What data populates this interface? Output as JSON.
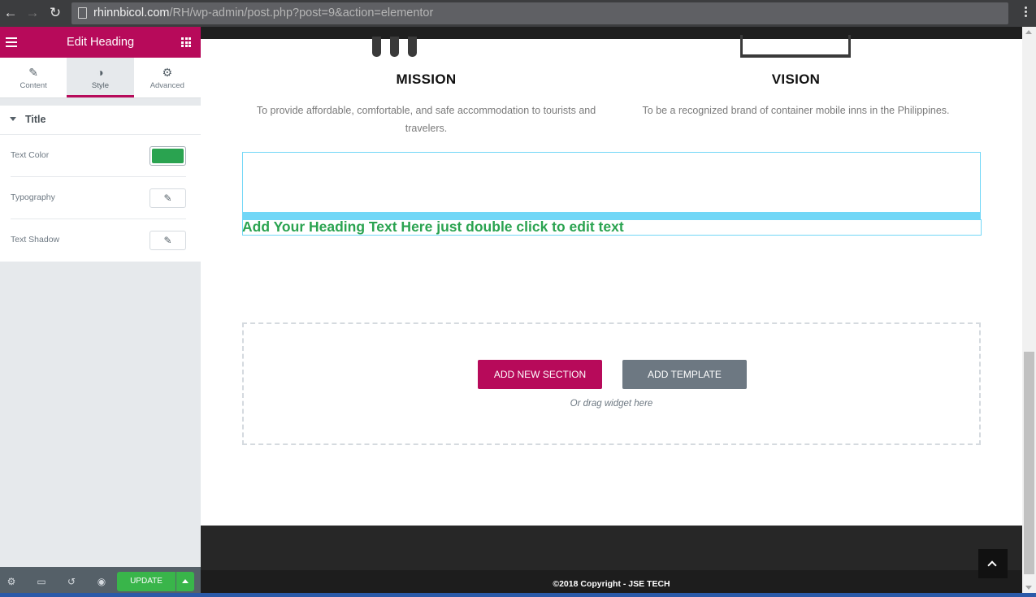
{
  "browser": {
    "url_host": "rhinnbicol.com",
    "url_path": "/RH/wp-admin/post.php?post=9&action=elementor",
    "back_icon": "back-arrow-icon",
    "forward_icon": "forward-arrow-icon",
    "reload_icon": "reload-icon"
  },
  "panel": {
    "title": "Edit Heading",
    "tabs": [
      {
        "label": "Content",
        "icon": "pencil-icon",
        "glyph": "✎"
      },
      {
        "label": "Style",
        "icon": "half-circle-icon",
        "glyph": "◑"
      },
      {
        "label": "Advanced",
        "icon": "gear-icon",
        "glyph": "⚙"
      }
    ],
    "active_tab": "Style",
    "section_title": "Title",
    "controls": [
      {
        "label": "Text Color",
        "type": "color",
        "value": "#2aa350"
      },
      {
        "label": "Typography",
        "type": "edit",
        "icon": "pencil-icon"
      },
      {
        "label": "Text Shadow",
        "type": "edit",
        "icon": "pencil-icon"
      }
    ],
    "footer": {
      "update_label": "UPDATE",
      "icons": [
        "settings-icon",
        "responsive-icon",
        "history-icon",
        "preview-icon"
      ]
    }
  },
  "canvas": {
    "mission": {
      "title": "MISSION",
      "text": "To provide affordable, comfortable, and safe accommodation to tourists and travelers."
    },
    "vision": {
      "title": "VISION",
      "text": "To be a recognized brand of container mobile inns in the Philippines."
    },
    "heading_text": "Add Your Heading Text Here just double click to edit text",
    "add_section_label": "ADD NEW SECTION",
    "add_template_label": "ADD TEMPLATE",
    "drag_hint": "Or drag widget here",
    "copyright": "©2018 Copyright - JSE TECH"
  },
  "colors": {
    "brand": "#b70a5a",
    "heading_green": "#2aa350",
    "update_green": "#39b54a",
    "selection_blue": "#71d7f7"
  }
}
